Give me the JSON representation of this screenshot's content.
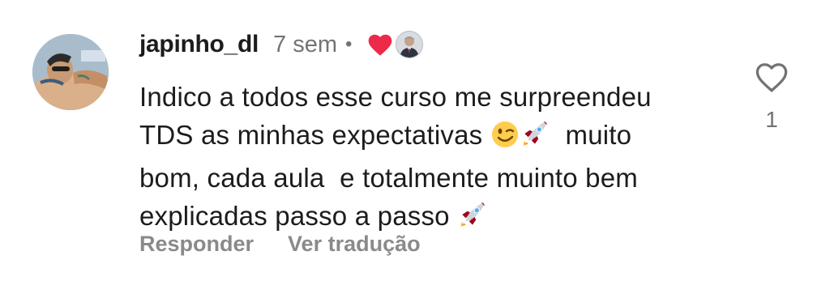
{
  "comment": {
    "username": "japinho_dl",
    "time": "7 sem",
    "separator": "•",
    "creator_liked": true,
    "body_lines": [
      "Indico a todos esse curso me surpreendeu",
      "TDS as minhas expectativas",
      "muito",
      "bom, cada aula  e totalmente muinto bem",
      "explicadas passo a passo"
    ],
    "emojis": [
      "winking-face",
      "rocket",
      "rocket"
    ],
    "actions": {
      "reply_label": "Responder",
      "translate_label": "Ver tradução"
    },
    "likes": {
      "count": "1",
      "icon": "heart-outline-icon"
    }
  },
  "colors": {
    "text": "#1c1c1c",
    "muted": "#737373",
    "action": "#8a8a8a",
    "heart": "#ed2a4a"
  }
}
